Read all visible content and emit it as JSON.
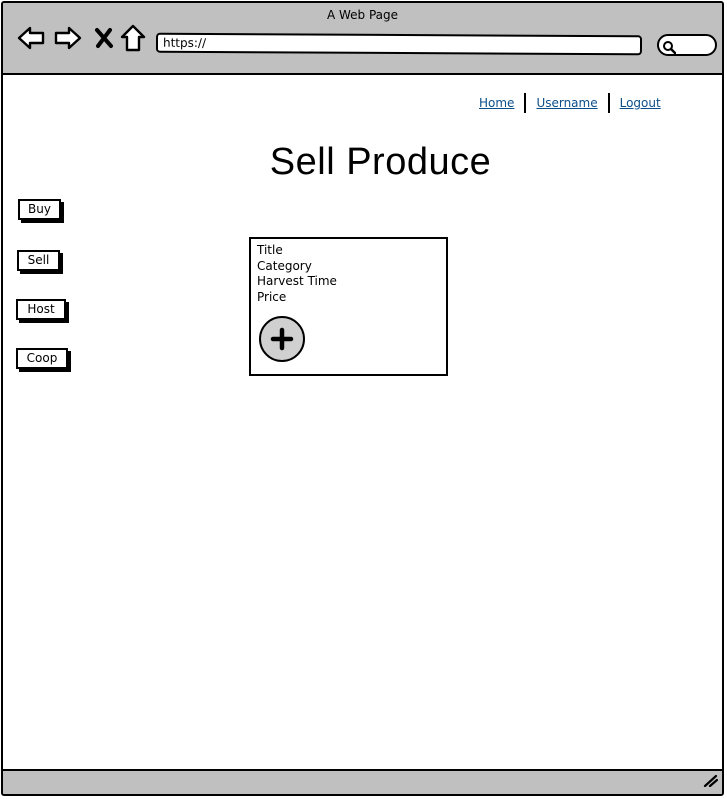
{
  "window": {
    "title": "A Web Page",
    "url": "https://"
  },
  "toolbar": {
    "icons": [
      "back-icon",
      "forward-icon",
      "close-icon",
      "home-icon",
      "search-icon"
    ]
  },
  "nav": {
    "links": [
      {
        "label": "Home"
      },
      {
        "label": "Username"
      },
      {
        "label": "Logout"
      }
    ],
    "link_color": "#0b4e8a"
  },
  "page": {
    "title": "Sell Produce"
  },
  "sidebar": {
    "buttons": [
      {
        "label": "Buy"
      },
      {
        "label": "Sell"
      },
      {
        "label": "Host"
      },
      {
        "label": "Coop"
      }
    ]
  },
  "card": {
    "fields": [
      "Title",
      "Category",
      "Harvest Time",
      "Price"
    ],
    "add_icon": "plus-icon"
  },
  "colors": {
    "chrome": "#c0c0c0",
    "add_button": "#d0d0d0"
  }
}
